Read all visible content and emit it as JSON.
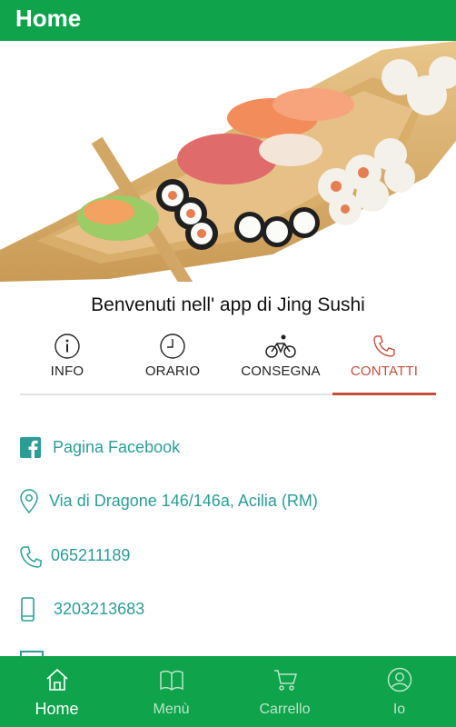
{
  "appbar": {
    "title": "Home"
  },
  "hero": {
    "alt_icon": "sushi-boat-photo",
    "slides": 4,
    "active_slide": 1
  },
  "welcome": "Benvenuti nell' app di Jing Sushi",
  "tabs": [
    {
      "label": "INFO",
      "icon": "info-icon"
    },
    {
      "label": "ORARIO",
      "icon": "clock-icon"
    },
    {
      "label": "CONSEGNA",
      "icon": "bicycle-icon"
    },
    {
      "label": "CONTATTI",
      "icon": "phone-icon",
      "active": true
    }
  ],
  "contacts": [
    {
      "text": "Pagina Facebook",
      "icon": "facebook-icon"
    },
    {
      "text": "Via di Dragone 146/146a, Acilia (RM)",
      "icon": "location-pin-icon"
    },
    {
      "text": "065211189",
      "icon": "phone-icon"
    },
    {
      "text": "3203213683",
      "icon": "mobile-phone-icon"
    }
  ],
  "bottom_nav": [
    {
      "label": "Home",
      "icon": "home-icon",
      "active": true
    },
    {
      "label": "Menù",
      "icon": "book-icon"
    },
    {
      "label": "Carrello",
      "icon": "cart-icon"
    },
    {
      "label": "Io",
      "icon": "user-icon"
    }
  ],
  "colors": {
    "primary": "#0fa34c",
    "accent": "#c0503c",
    "link": "#2a9d96",
    "dot_active": "#1976d2"
  }
}
